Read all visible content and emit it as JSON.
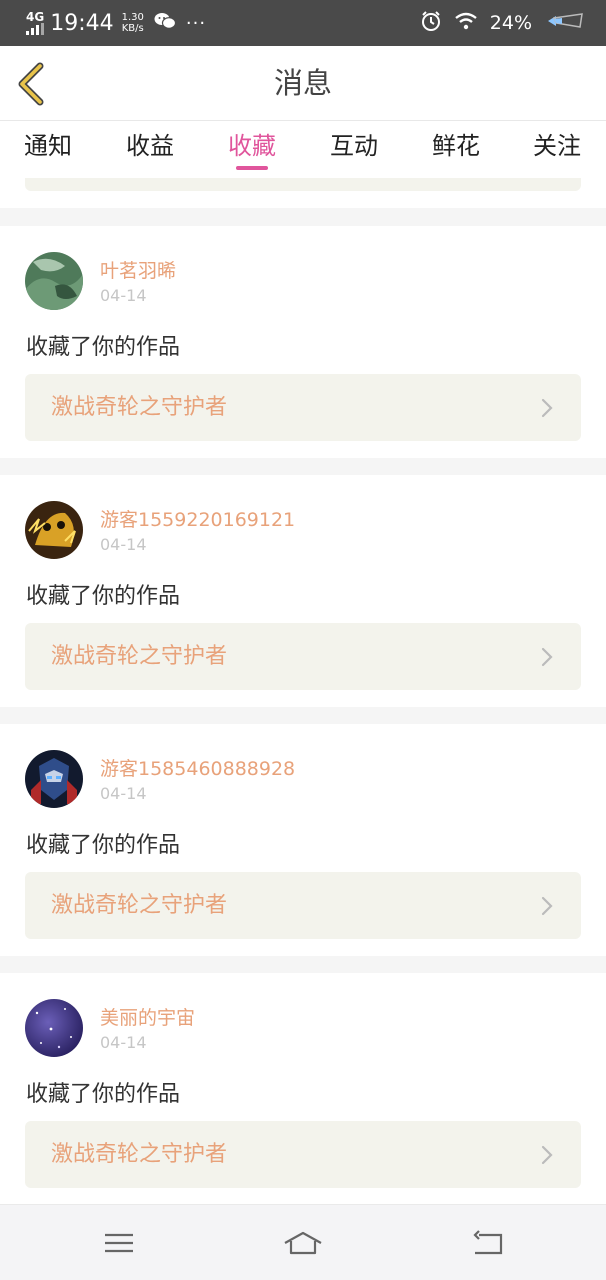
{
  "status_bar": {
    "network": "4G",
    "time": "19:44",
    "speed_value": "1.30",
    "speed_unit": "KB/s",
    "dots": "···",
    "battery": "24%"
  },
  "header": {
    "title": "消息"
  },
  "tabs": [
    {
      "label": "通知"
    },
    {
      "label": "收益"
    },
    {
      "label": "收藏",
      "active": true
    },
    {
      "label": "互动"
    },
    {
      "label": "鲜花"
    },
    {
      "label": "关注"
    }
  ],
  "messages": [
    {
      "username": "叶茗羽晞",
      "date": "04-14",
      "action": "收藏了你的作品",
      "work_title": "激战奇轮之守护者"
    },
    {
      "username": "游客1559220169121",
      "date": "04-14",
      "action": "收藏了你的作品",
      "work_title": "激战奇轮之守护者"
    },
    {
      "username": "游客1585460888928",
      "date": "04-14",
      "action": "收藏了你的作品",
      "work_title": "激战奇轮之守护者"
    },
    {
      "username": "美丽的宇宙",
      "date": "04-14",
      "action": "收藏了你的作品",
      "work_title": "激战奇轮之守护者"
    }
  ],
  "colors": {
    "accent": "#e0559c",
    "link_text": "#e8a27a",
    "back_arrow": "#e9c44a",
    "status_bar_bg": "#4a4a4a"
  },
  "icons": [
    "signal-icon",
    "wechat-icon",
    "alarm-icon",
    "wifi-icon",
    "battery-icon",
    "back-arrow-icon",
    "chevron-right-icon",
    "menu-icon",
    "home-icon",
    "return-icon"
  ]
}
